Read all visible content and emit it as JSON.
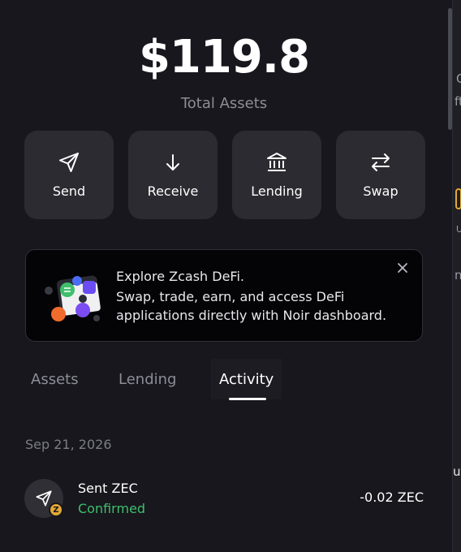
{
  "balance": {
    "total": "$119.8",
    "label": "Total Assets"
  },
  "actions": [
    {
      "label": "Send",
      "icon": "send-icon"
    },
    {
      "label": "Receive",
      "icon": "arrow-down-icon"
    },
    {
      "label": "Lending",
      "icon": "bank-icon"
    },
    {
      "label": "Swap",
      "icon": "swap-icon"
    }
  ],
  "banner": {
    "title": "Explore Zcash DeFi.",
    "text": "Swap, trade, earn, and access DeFi applications directly with Noir dashboard."
  },
  "tabs": [
    {
      "label": "Assets",
      "active": false
    },
    {
      "label": "Lending",
      "active": false
    },
    {
      "label": "Activity",
      "active": true
    }
  ],
  "activity": {
    "date": "Sep 21, 2026",
    "items": [
      {
        "title": "Sent ZEC",
        "status": "Confirmed",
        "amount": "-0.02 ZEC",
        "coin": "Z"
      }
    ]
  },
  "background_fragments": [
    "C",
    "ft",
    "U",
    "nv",
    "ut"
  ],
  "colors": {
    "background": "#17171d",
    "card": "#2b2b31",
    "confirmed": "#3fbf6c",
    "zec_coin": "#e4a834"
  }
}
